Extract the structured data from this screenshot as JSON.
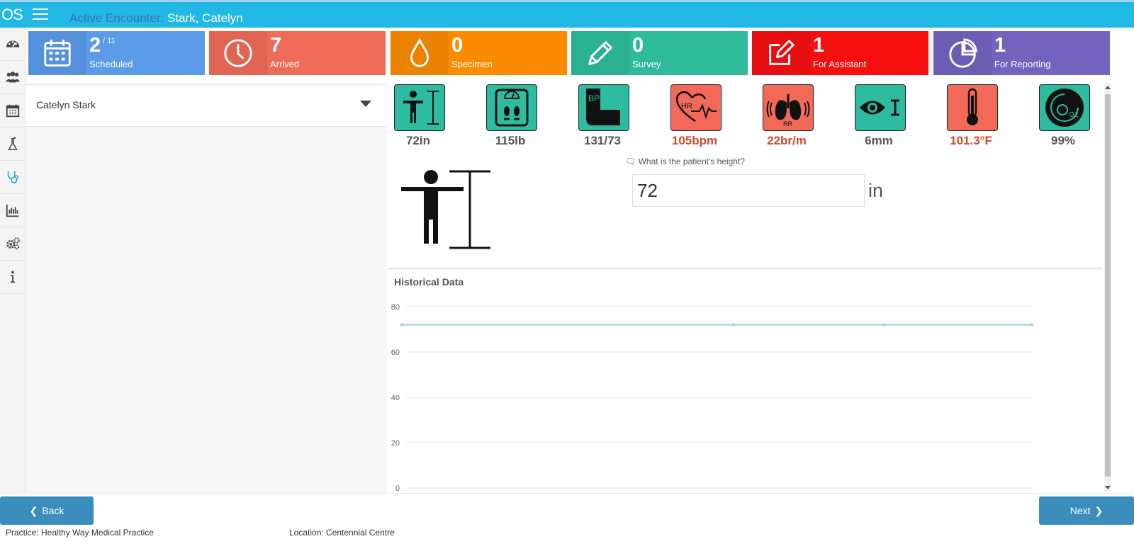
{
  "header": {
    "logo_text": "OS",
    "title_prefix": "Active Encounter:",
    "patient_name": "Stark, Catelyn"
  },
  "sidebar": {
    "items": [
      {
        "icon": "dashboard-icon"
      },
      {
        "icon": "patients-icon"
      },
      {
        "icon": "calendar-icon"
      },
      {
        "icon": "lab-icon"
      },
      {
        "icon": "stethoscope-icon",
        "active": true
      },
      {
        "icon": "reports-icon"
      },
      {
        "icon": "settings-icon"
      },
      {
        "icon": "info-icon"
      }
    ]
  },
  "cards": [
    {
      "count": "2",
      "total": "/ 11",
      "label": "Scheduled",
      "color": "#5b9be8",
      "icon": "calendar-icon"
    },
    {
      "count": "7",
      "label": "Arrived",
      "color": "#ee6b57",
      "icon": "clock-icon"
    },
    {
      "count": "0",
      "label": "Specimen",
      "color": "#fb8c00",
      "icon": "drop-icon"
    },
    {
      "count": "0",
      "label": "Survey",
      "color": "#2dbb9c",
      "icon": "pencil-icon"
    },
    {
      "count": "1",
      "label": "For Assistant",
      "color": "#f50f0f",
      "icon": "edit-icon"
    },
    {
      "count": "1",
      "label": "For Reporting",
      "color": "#7462bf",
      "icon": "pie-icon"
    }
  ],
  "patient_select": {
    "name": "Catelyn Stark"
  },
  "vitals": [
    {
      "key": "height",
      "value": "72in",
      "icon": "height-icon",
      "alert": false
    },
    {
      "key": "weight",
      "value": "115lb",
      "icon": "scale-icon",
      "alert": false
    },
    {
      "key": "blood_pressure",
      "value": "131/73",
      "icon": "bp-icon",
      "icon_text": "BP",
      "alert": false
    },
    {
      "key": "heart_rate",
      "value": "105bpm",
      "icon": "heart-rate-icon",
      "icon_text": "HR",
      "alert": true
    },
    {
      "key": "respiratory_rate",
      "value": "22br/m",
      "icon": "lungs-icon",
      "icon_text": "RR",
      "alert": true
    },
    {
      "key": "pupil",
      "value": "6mm",
      "icon": "eye-icon",
      "alert": false
    },
    {
      "key": "temperature",
      "value": "101.3°F",
      "icon": "thermometer-icon",
      "alert": true
    },
    {
      "key": "oxygen",
      "value": "99%",
      "icon": "oxygen-icon",
      "icon_text": "O2",
      "alert": false
    }
  ],
  "question": {
    "text": "What is the patient's height?",
    "value": "72",
    "unit": "in"
  },
  "history": {
    "title": "Historical Data"
  },
  "chart_data": {
    "type": "line",
    "x": [
      1,
      2,
      3,
      4
    ],
    "series": [
      {
        "values": [
          72,
          72,
          72,
          72
        ]
      }
    ],
    "ylim": [
      0,
      80
    ],
    "yticks": [
      "80",
      "60",
      "40",
      "20",
      "0"
    ],
    "grid": true,
    "color": "#9ccfe0"
  },
  "footer": {
    "back_label": "Back",
    "next_label": "Next",
    "practice": "Practice: Healthy Way Medical Practice",
    "location": "Location: Centennial Centre"
  }
}
